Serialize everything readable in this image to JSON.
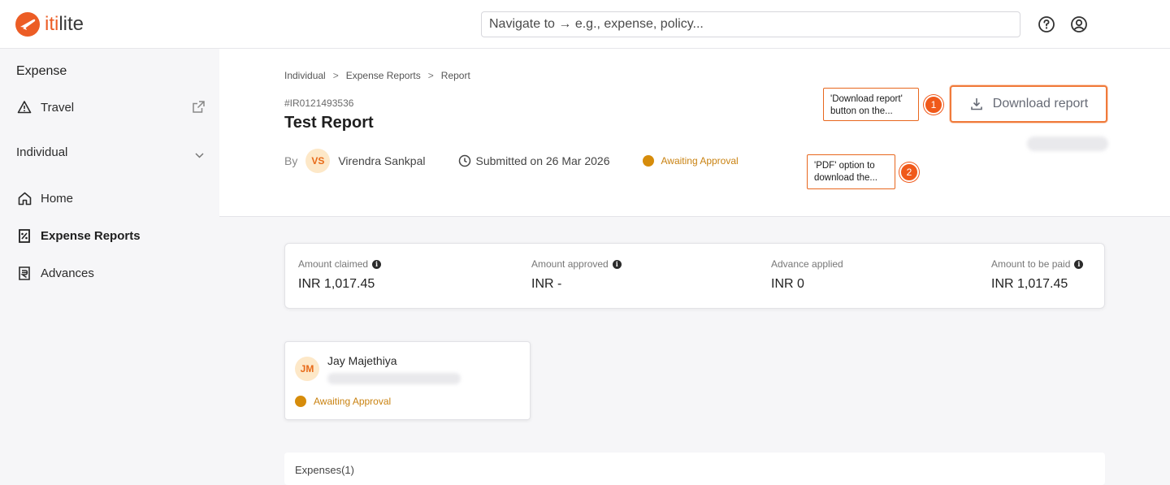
{
  "app": {
    "logo_text_accent": "iti",
    "logo_text_rest": "lite",
    "accent_color": "#ec5d25"
  },
  "search": {
    "placeholder": "Navigate to → e.g., expense, policy..."
  },
  "top_icons": [
    "help-icon",
    "user-profile-icon"
  ],
  "sidebar": {
    "heading": "Expense",
    "travel_label": "Travel",
    "section_label": "Individual",
    "items": [
      {
        "label": "Home",
        "icon": "home-icon"
      },
      {
        "label": "Expense Reports",
        "icon": "expense-report-icon",
        "active": true
      },
      {
        "label": "Advances",
        "icon": "advances-icon"
      }
    ]
  },
  "breadcrumb": {
    "items": [
      "Individual",
      "Expense Reports",
      "Report"
    ],
    "separator": ">"
  },
  "report": {
    "id": "#IR0121493536",
    "title": "Test Report",
    "by_label": "By",
    "submitter_initials": "VS",
    "submitter_name": "Virendra Sankpal",
    "submitted_text": "Submitted on 26 Mar 2026",
    "status": "Awaiting Approval",
    "status_color": "#d68c0b"
  },
  "download_button": {
    "label": "Download report"
  },
  "callouts": [
    {
      "number": "1",
      "text": "'Download report' button on the..."
    },
    {
      "number": "2",
      "text": "'PDF' option to download the..."
    }
  ],
  "summary": [
    {
      "label": "Amount claimed",
      "value": "INR 1,017.45",
      "info": true
    },
    {
      "label": "Amount approved",
      "value": "INR -",
      "info": true
    },
    {
      "label": "Advance applied",
      "value": "INR 0",
      "info": false
    },
    {
      "label": "Amount to be paid",
      "value": "INR 1,017.45",
      "info": true
    }
  ],
  "approver": {
    "initials": "JM",
    "name": "Jay Majethiya",
    "status": "Awaiting Approval"
  },
  "expenses": {
    "title": "Expenses(1)"
  }
}
